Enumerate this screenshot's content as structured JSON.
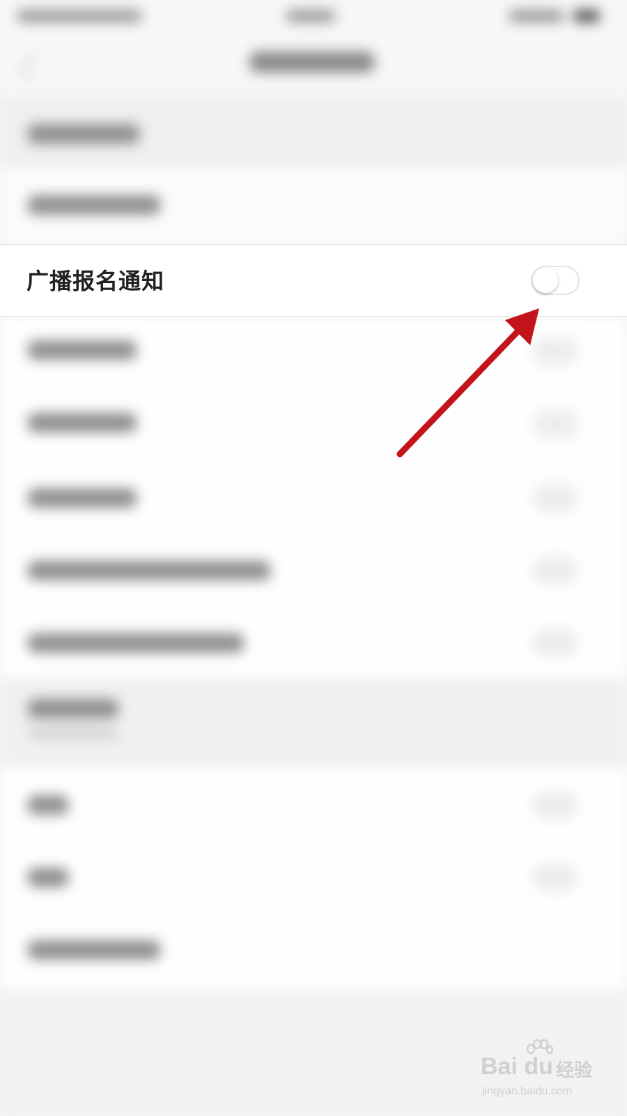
{
  "settings": {
    "focused_row": {
      "label": "广播报名通知",
      "toggle_on": false
    }
  },
  "watermark": {
    "brand": "Bai du",
    "brand_suffix": "经验",
    "url": "jingyan.baidu.com"
  },
  "colors": {
    "arrow": "#c4141b",
    "label": "#222222",
    "background": "#f4f4f4"
  },
  "icons": {
    "back": "chevron-left-icon",
    "arrow": "red-arrow-annotation",
    "paw": "baidu-paw-icon"
  }
}
